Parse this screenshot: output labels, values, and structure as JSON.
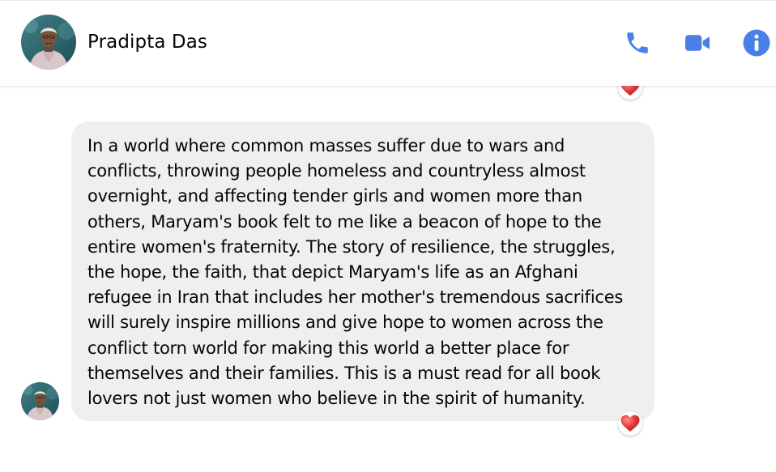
{
  "header": {
    "contact_name": "Pradipta Das",
    "icons": {
      "call": "phone-icon",
      "video": "video-camera-icon",
      "info": "info-icon"
    },
    "accent_color": "#4a7fe8"
  },
  "thread": {
    "previous_message": {
      "reaction": "heart-reaction-icon"
    },
    "message": {
      "sender": "Pradipta Das",
      "text": "In a world where common masses suffer due to wars and\nconflicts,  throwing people homeless and countryless almost\novernight, and affecting tender girls and women more than\nothers,  Maryam's book felt to me like a beacon of hope to the\nentire women's fraternity. The story of resilience, the struggles,\nthe hope, the faith, that depict Maryam's life as an Afghani\nrefugee in Iran that includes her mother's tremendous sacrifices\nwill surely inspire millions and give hope to women across the\nconflict torn world for making this world a better place for\nthemselves and their families. This is a must read for all book\nlovers not just women who believe in the spirit of humanity.",
      "reaction": "heart-reaction-icon",
      "bubble_color": "#efefef"
    }
  }
}
